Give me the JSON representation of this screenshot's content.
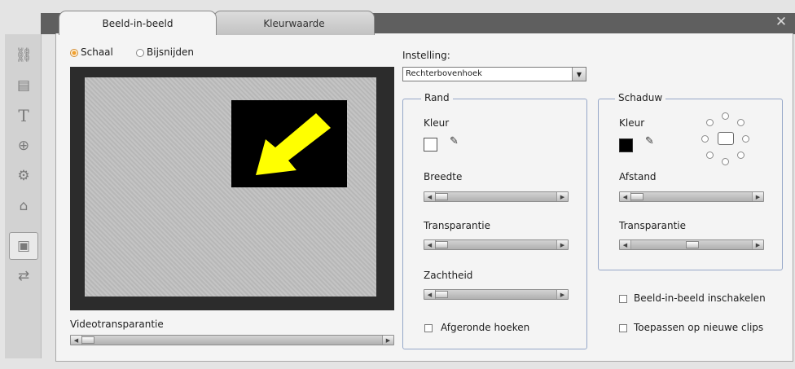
{
  "tabs": [
    {
      "label": "Beeld-in-beeld",
      "active": true
    },
    {
      "label": "Kleurwaarde",
      "active": false
    }
  ],
  "toolbar": {
    "icons": [
      "video-tools-icon",
      "title-icon",
      "text-icon",
      "color-icon",
      "effects-icon",
      "transitions-icon",
      "picture-in-picture-icon",
      "speed-icon"
    ],
    "active": "picture-in-picture-icon"
  },
  "mode": {
    "options": [
      {
        "label": "Schaal",
        "selected": true
      },
      {
        "label": "Bijsnijden",
        "selected": false
      }
    ]
  },
  "preset": {
    "label": "Instelling:",
    "value": "Rechterbovenhoek"
  },
  "video_transparency": {
    "label": "Videotransparantie",
    "value": 0
  },
  "border": {
    "title": "Rand",
    "color_label": "Kleur",
    "color": "#ffffff",
    "width_label": "Breedte",
    "width_value": 0,
    "transparency_label": "Transparantie",
    "transparency_value": 0,
    "softness_label": "Zachtheid",
    "softness_value": 0,
    "rounded_label": "Afgeronde hoeken",
    "rounded_checked": false
  },
  "shadow": {
    "title": "Schaduw",
    "color_label": "Kleur",
    "color": "#000000",
    "distance_label": "Afstand",
    "distance_value": 0,
    "transparency_label": "Transparantie",
    "transparency_value": 0.5,
    "direction": "center"
  },
  "options": {
    "enable_pip_label": "Beeld-in-beeld inschakelen",
    "enable_pip_checked": false,
    "apply_new_clips_label": "Toepassen op nieuwe clips",
    "apply_new_clips_checked": false
  },
  "colors": {
    "preview_frame": "#2c2c2c",
    "preview_canvas": "#b7b7b7",
    "arrow": "#ffff00",
    "group_border": "#95a7c8"
  }
}
